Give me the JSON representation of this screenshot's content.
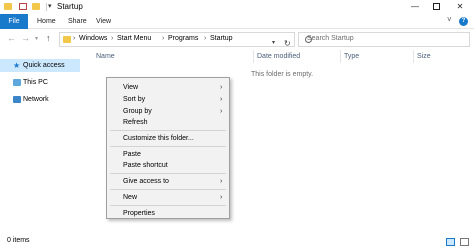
{
  "window": {
    "title": "Startup",
    "controls": {
      "minimize": "—",
      "close": "✕"
    }
  },
  "ribbon": {
    "tabs": [
      "File",
      "Home",
      "Share",
      "View"
    ]
  },
  "address": {
    "crumbs": [
      "Windows",
      "Start Menu",
      "Programs",
      "Startup"
    ],
    "separator": "›"
  },
  "search": {
    "placeholder": "Search Startup"
  },
  "nav_pane": {
    "items": [
      {
        "label": "Quick access",
        "icon": "star-icon",
        "selected": true
      },
      {
        "label": "This PC",
        "icon": "computer-icon",
        "selected": false
      },
      {
        "label": "Network",
        "icon": "network-icon",
        "selected": false
      }
    ]
  },
  "columns": [
    "Name",
    "Date modified",
    "Type",
    "Size"
  ],
  "empty_message": "This folder is empty.",
  "context_menu": {
    "items": [
      {
        "label": "View",
        "submenu": true
      },
      {
        "label": "Sort by",
        "submenu": true
      },
      {
        "label": "Group by",
        "submenu": true
      },
      {
        "label": "Refresh",
        "submenu": false
      },
      {
        "label": "Customize this folder...",
        "submenu": false
      },
      {
        "label": "Paste",
        "submenu": false
      },
      {
        "label": "Paste shortcut",
        "submenu": false
      },
      {
        "label": "Give access to",
        "submenu": true
      },
      {
        "label": "New",
        "submenu": true
      },
      {
        "label": "Properties",
        "submenu": false
      }
    ]
  },
  "status": {
    "item_count": "0 items"
  },
  "colors": {
    "accent": "#1979ca",
    "selection": "#cce8ff",
    "folder": "#f3c74a"
  }
}
